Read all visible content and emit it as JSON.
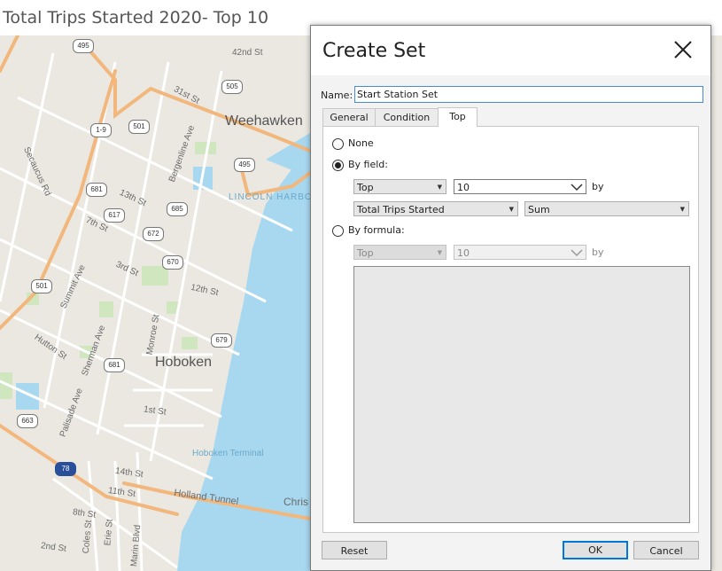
{
  "worksheet": {
    "title": "Total Trips Started 2020- Top 10"
  },
  "map": {
    "place_labels": {
      "weehawken": "Weehawken",
      "hoboken": "Hoboken",
      "lincoln_harbor": "LINCOLN HARBOR",
      "hoboken_terminal": "Hoboken Terminal",
      "secaucus_rd": "Secaucus Rd",
      "st_42nd": "42nd St",
      "st_31st": "31st St",
      "bergenline_ave": "Bergenline Ave",
      "st_13th": "13th St",
      "st_7th": "7th St",
      "st_3rd": "3rd St",
      "summit_ave": "Summit Ave",
      "hutton_st": "Hutton St",
      "sherman_ave": "Sherman Ave",
      "palisade_ave": "Palisade Ave",
      "monroe_st": "Monroe St",
      "st_12th": "12th St",
      "st_1st": "1st St",
      "st_14th": "14th St",
      "st_11th": "11th St",
      "holland_tunnel": "Holland Tunnel",
      "chris": "Chris",
      "st_8th": "8th St",
      "st_2nd": "2nd St",
      "coles_st": "Coles St",
      "erie_st": "Erie St",
      "marin_blvd": "Marin Blvd"
    },
    "shields": {
      "s495a": "495",
      "s505": "505",
      "s1_9": "1-9",
      "s501a": "501",
      "s495b": "495",
      "s681a": "681",
      "s617": "617",
      "s685": "685",
      "s672": "672",
      "s670": "670",
      "s501b": "501",
      "s679": "679",
      "s681b": "681",
      "s663": "663",
      "s78": "78"
    },
    "colors": {
      "land": "#ebe8e1",
      "water": "#a8d8f0",
      "highway": "#f2b77d",
      "park": "#cfe6bf"
    }
  },
  "dialog": {
    "title": "Create Set",
    "close_icon": "close-icon",
    "name_label": "Name:",
    "name_value": "Start Station Set",
    "tabs": [
      {
        "label": "General",
        "active": false
      },
      {
        "label": "Condition",
        "active": false
      },
      {
        "label": "Top",
        "active": true
      }
    ],
    "options": {
      "none_label": "None",
      "by_field_label": "By field:",
      "by_formula_label": "By formula:",
      "selected": "By field:"
    },
    "by_field": {
      "top_bottom": "Top",
      "count": "10",
      "by_label": "by",
      "field": "Total Trips Started",
      "aggregation": "Sum"
    },
    "by_formula": {
      "top_bottom": "Top",
      "count": "10",
      "by_label": "by",
      "formula": ""
    },
    "buttons": {
      "reset": "Reset",
      "ok": "OK",
      "cancel": "Cancel"
    },
    "colors": {
      "focus_border": "#0078d7"
    }
  }
}
